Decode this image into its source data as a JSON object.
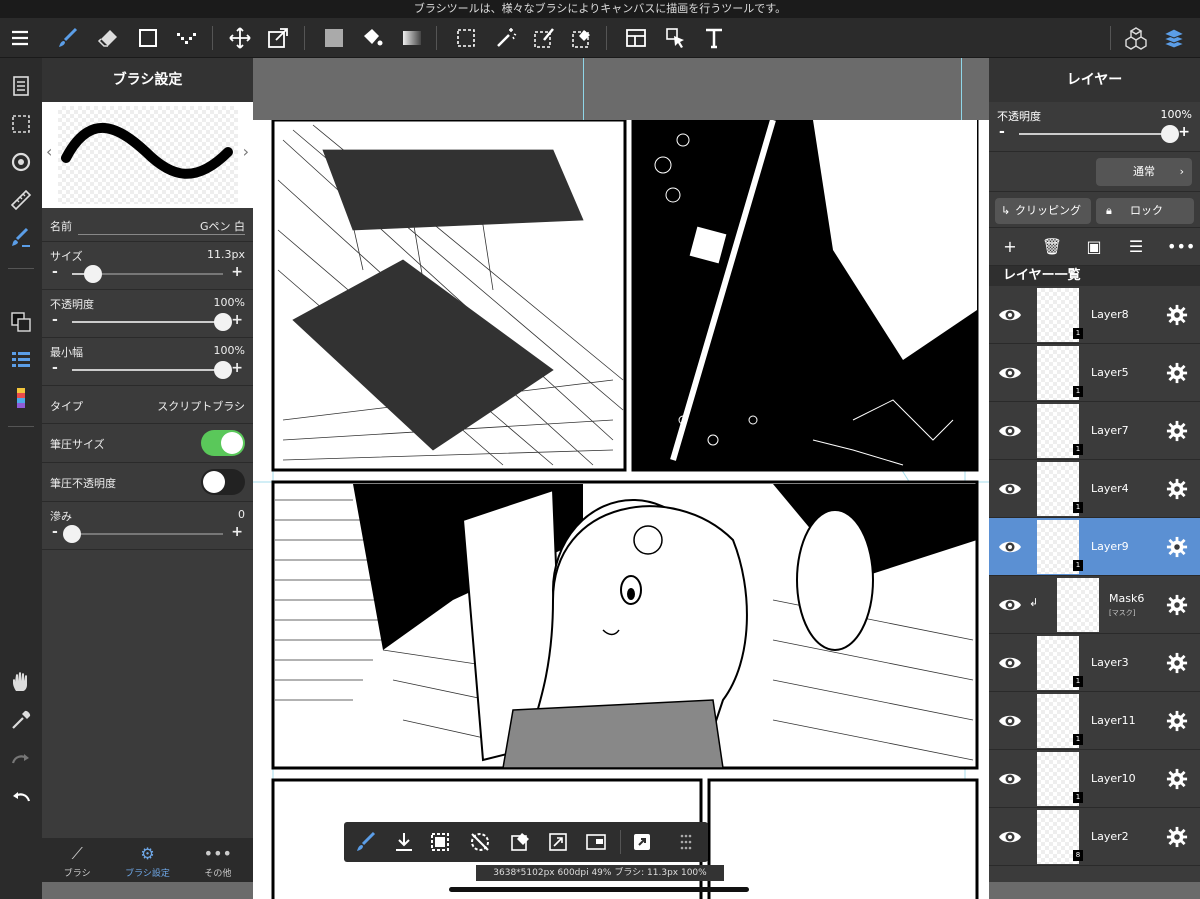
{
  "hint": "ブラシツールは、様々なブラシによりキャンバスに描画を行うツールです。",
  "brush_panel": {
    "title": "ブラシ設定",
    "name_label": "名前",
    "name_value": "Gペン 白",
    "size_label": "サイズ",
    "size_value": "11.3px",
    "size_level": 0.14,
    "opacity_label": "不透明度",
    "opacity_value": "100%",
    "opacity_level": 1.0,
    "minwidth_label": "最小幅",
    "minwidth_value": "100%",
    "minwidth_level": 1.0,
    "type_label": "タイプ",
    "type_value": "スクリプトブラシ",
    "pressure_size_label": "筆圧サイズ",
    "pressure_size_on": true,
    "pressure_opacity_label": "筆圧不透明度",
    "pressure_opacity_on": false,
    "blur_label": "滲み",
    "blur_value": "0",
    "blur_level": 0.0,
    "minus": "-",
    "plus": "+"
  },
  "bottom_tabs": [
    {
      "label": "ブラシ",
      "icon": "brush-icon"
    },
    {
      "label": "ブラシ設定",
      "icon": "brush-settings-icon"
    },
    {
      "label": "その他",
      "icon": "more-icon"
    }
  ],
  "layer_panel": {
    "title": "レイヤー",
    "opacity_label": "不透明度",
    "opacity_value": "100%",
    "opacity_level": 1.0,
    "blend_mode": "通常",
    "clipping_label": "クリッピング",
    "lock_label": "ロック",
    "list_title": "レイヤー一覧",
    "layers": [
      {
        "name": "Layer8",
        "badge": "1",
        "selected": false
      },
      {
        "name": "Layer5",
        "badge": "1",
        "selected": false
      },
      {
        "name": "Layer7",
        "badge": "1",
        "selected": false
      },
      {
        "name": "Layer4",
        "badge": "1",
        "selected": false
      },
      {
        "name": "Layer9",
        "badge": "1",
        "selected": true
      },
      {
        "name": "Mask6",
        "sub": "[マスク]",
        "badge": "",
        "selected": false
      },
      {
        "name": "Layer3",
        "badge": "1",
        "selected": false
      },
      {
        "name": "Layer11",
        "badge": "1",
        "selected": false
      },
      {
        "name": "Layer10",
        "badge": "1",
        "selected": false
      },
      {
        "name": "Layer2",
        "badge": "8",
        "selected": false
      }
    ]
  },
  "status_line": "3638*5102px 600dpi 49% ブラシ: 11.3px 100%",
  "colors": {
    "accent": "#5b90d3",
    "toggle_on": "#5ac85a",
    "toolbar": "#2b2b2b"
  }
}
